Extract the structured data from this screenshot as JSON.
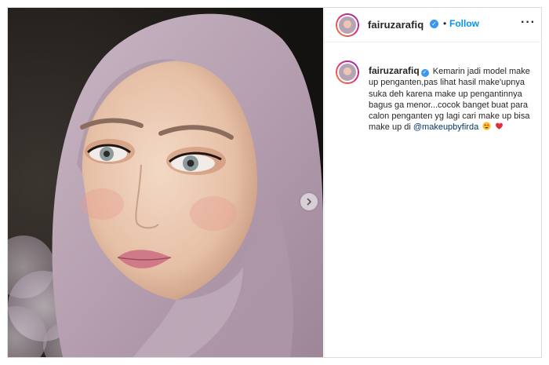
{
  "post": {
    "username": "fairuzarafiq",
    "separator": "•",
    "follow_label": "Follow",
    "more_label": "···",
    "verified_glyph": "✓",
    "carousel_next_glyph": "›"
  },
  "caption": {
    "username": "fairuzarafiq",
    "text": "Kemarin jadi model make up penganten,pas lihat hasil make'upnya suka deh karena make up pengantinnya bagus ga menor...cocok banget buat para calon penganten yg lagi cari make up bisa make up di",
    "mention": "@makeupbyfirda",
    "emojis": [
      "star-struck-emoji",
      "red-heart-emoji"
    ]
  },
  "colors": {
    "link_blue": "#0095f6",
    "verified_blue": "#3897f0",
    "mention": "#00376b",
    "hijab": "#b9a4b4"
  },
  "icons": [
    "verified-badge-icon",
    "more-options-icon",
    "carousel-next-icon"
  ]
}
